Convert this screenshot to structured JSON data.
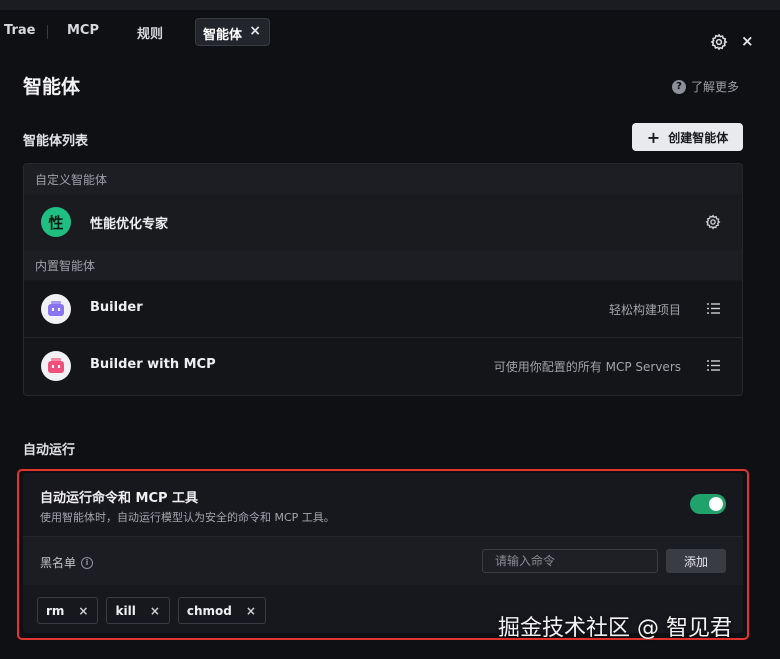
{
  "tabs": {
    "items": [
      {
        "label": "Trae"
      },
      {
        "label": "MCP"
      },
      {
        "label": "规则"
      },
      {
        "label": "智能体",
        "active": true
      }
    ],
    "close_glyph": "×"
  },
  "window": {
    "settings_icon": "gear-icon",
    "close_glyph": "×"
  },
  "header": {
    "title": "智能体",
    "learn_more": "了解更多",
    "help_glyph": "?"
  },
  "agents": {
    "section_label": "智能体列表",
    "create_button": "创建智能体",
    "create_plus": "+",
    "custom_group_label": "自定义智能体",
    "custom": [
      {
        "name": "性能优化专家",
        "avatar_text": "性",
        "avatar_color": "#1fbf82"
      }
    ],
    "builtin_group_label": "内置智能体",
    "builtin": [
      {
        "name": "Builder",
        "description": "轻松构建项目",
        "avatar_color": "#8b74f0"
      },
      {
        "name": "Builder with MCP",
        "description": "可使用你配置的所有 MCP Servers",
        "avatar_color": "#ef4f7a"
      }
    ]
  },
  "auto_run": {
    "section_label": "自动运行",
    "title": "自动运行命令和 MCP 工具",
    "description": "使用智能体时，自动运行模型认为安全的命令和 MCP 工具。",
    "enabled": true,
    "toggle_color": "#1fa36a",
    "blacklist_label": "黑名单",
    "info_glyph": "i",
    "input_placeholder": "请输入命令",
    "input_value": "",
    "add_button": "添加",
    "commands": [
      "rm",
      "kill",
      "chmod"
    ],
    "remove_glyph": "×"
  },
  "watermark": "掘金技术社区 @ 智见君",
  "colors": {
    "background": "#0f1013",
    "panel": "#17181d",
    "highlight_frame": "#e3342f"
  }
}
